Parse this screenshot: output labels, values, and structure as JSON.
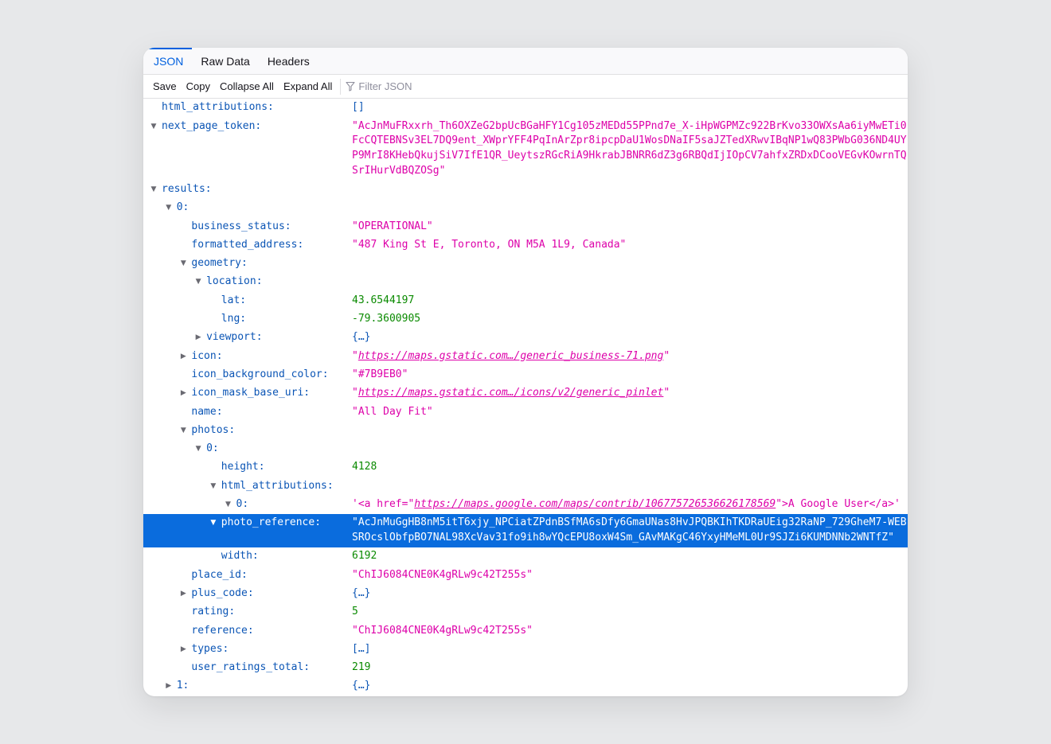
{
  "tabs": [
    {
      "label": "JSON",
      "active": true
    },
    {
      "label": "Raw Data",
      "active": false
    },
    {
      "label": "Headers",
      "active": false
    }
  ],
  "toolbar": {
    "save": "Save",
    "copy": "Copy",
    "collapse_all": "Collapse All",
    "expand_all": "Expand All",
    "filter_placeholder": "Filter JSON"
  },
  "colors": {
    "key": "#0b55b5",
    "string": "#dd00a9",
    "number": "#0a8a00",
    "selection": "#0a6cdd",
    "tab_active": "#0060df"
  },
  "rows": [
    {
      "depth": 0,
      "key": "html_attributions:",
      "twisty": "none",
      "type": "plain",
      "value": "[]"
    },
    {
      "depth": 0,
      "key": "next_page_token:",
      "twisty": "open",
      "type": "str",
      "value": "\"AcJnMuFRxxrh_Th6OXZeG2bpUcBGaHFY1Cg105zMEDd55PPnd7e_X-iHpWGPMZc922BrKvo33OWXsAa6iyMwETi0FcCQTEBNSv3EL7DQ9ent_XWprYFF4PqInArZpr8ipcpDaU1WosDNaIF5saJZTedXRwvIBqNP1wQ83PWbG036ND4UYP9MrI8KHebQkujSiV7IfE1QR_UeytszRGcRiA9HkrabJBNRR6dZ3g6RBQdIjIOpCV7ahfxZRDxDCooVEGvKOwrnTQSrIHurVdBQZOSg\""
    },
    {
      "depth": 0,
      "key": "results:",
      "twisty": "open",
      "type": "none",
      "value": ""
    },
    {
      "depth": 1,
      "key": "0:",
      "twisty": "open",
      "type": "none",
      "value": ""
    },
    {
      "depth": 2,
      "key": "business_status:",
      "twisty": "none",
      "type": "str",
      "value": "\"OPERATIONAL\""
    },
    {
      "depth": 2,
      "key": "formatted_address:",
      "twisty": "none",
      "type": "str",
      "value": "\"487 King St E, Toronto, ON M5A 1L9, Canada\""
    },
    {
      "depth": 2,
      "key": "geometry:",
      "twisty": "open",
      "type": "none",
      "value": ""
    },
    {
      "depth": 3,
      "key": "location:",
      "twisty": "open",
      "type": "none",
      "value": ""
    },
    {
      "depth": 4,
      "key": "lat:",
      "twisty": "none",
      "type": "num",
      "value": "43.6544197"
    },
    {
      "depth": 4,
      "key": "lng:",
      "twisty": "none",
      "type": "num",
      "value": "-79.3600905"
    },
    {
      "depth": 3,
      "key": "viewport:",
      "twisty": "closed",
      "type": "plain",
      "value": "{…}"
    },
    {
      "depth": 2,
      "key": "icon:",
      "twisty": "closed",
      "type": "link",
      "value": "https://maps.gstatic.com…/generic_business-71.png"
    },
    {
      "depth": 2,
      "key": "icon_background_color:",
      "twisty": "none",
      "type": "str",
      "value": "\"#7B9EB0\""
    },
    {
      "depth": 2,
      "key": "icon_mask_base_uri:",
      "twisty": "closed",
      "type": "link",
      "value": "https://maps.gstatic.com…/icons/v2/generic_pinlet"
    },
    {
      "depth": 2,
      "key": "name:",
      "twisty": "none",
      "type": "str",
      "value": "\"All Day Fit\""
    },
    {
      "depth": 2,
      "key": "photos:",
      "twisty": "open",
      "type": "none",
      "value": ""
    },
    {
      "depth": 3,
      "key": "0:",
      "twisty": "open",
      "type": "none",
      "value": ""
    },
    {
      "depth": 4,
      "key": "height:",
      "twisty": "none",
      "type": "num",
      "value": "4128"
    },
    {
      "depth": 4,
      "key": "html_attributions:",
      "twisty": "open",
      "type": "none",
      "value": ""
    },
    {
      "depth": 5,
      "key": "0:",
      "twisty": "open",
      "type": "anchor",
      "value": {
        "pre": "'<a href=\"",
        "link": "https://maps.google.com/maps/contrib/106775726536626178569",
        "post": "\">A Google User</a>'"
      }
    },
    {
      "depth": 4,
      "key": "photo_reference:",
      "twisty": "open",
      "type": "str",
      "selected": true,
      "value": "\"AcJnMuGgHB8nM5itT6xjy_NPCiatZPdnBSfMA6sDfy6GmaUNas8HvJPQBKIhTKDRaUEig32RaNP_729GheM7-WEBSROcslObfpBO7NAL98XcVav31fo9ih8wYQcEPU8oxW4Sm_GAvMAKgC46YxyHMeML0Ur9SJZi6KUMDNNb2WNTfZ\""
    },
    {
      "depth": 4,
      "key": "width:",
      "twisty": "none",
      "type": "num",
      "value": "6192"
    },
    {
      "depth": 2,
      "key": "place_id:",
      "twisty": "none",
      "type": "str",
      "value": "\"ChIJ6084CNE0K4gRLw9c42T255s\""
    },
    {
      "depth": 2,
      "key": "plus_code:",
      "twisty": "closed",
      "type": "plain",
      "value": "{…}"
    },
    {
      "depth": 2,
      "key": "rating:",
      "twisty": "none",
      "type": "num",
      "value": "5"
    },
    {
      "depth": 2,
      "key": "reference:",
      "twisty": "none",
      "type": "str",
      "value": "\"ChIJ6084CNE0K4gRLw9c42T255s\""
    },
    {
      "depth": 2,
      "key": "types:",
      "twisty": "closed",
      "type": "plain",
      "value": "[…]"
    },
    {
      "depth": 2,
      "key": "user_ratings_total:",
      "twisty": "none",
      "type": "num",
      "value": "219"
    },
    {
      "depth": 1,
      "key": "1:",
      "twisty": "closed",
      "type": "plain",
      "value": "{…}"
    }
  ]
}
